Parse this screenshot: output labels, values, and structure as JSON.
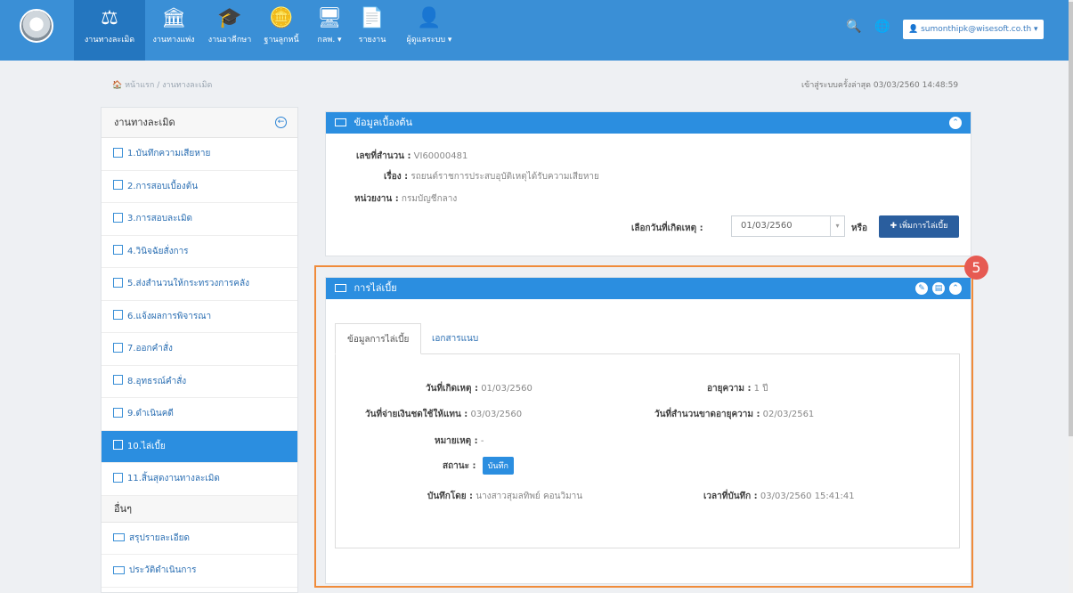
{
  "nav": {
    "items": [
      {
        "label": "งานทางละเมิด",
        "icon": "gavel-icon"
      },
      {
        "label": "งานทางแพ่ง",
        "icon": "bank-icon"
      },
      {
        "label": "งานอาคีกษา",
        "icon": "graduation-cap-icon"
      },
      {
        "label": "ฐานลูกหนี้",
        "icon": "coins-icon"
      },
      {
        "label": "กลพ. ▾",
        "icon": "monitor-icon"
      },
      {
        "label": "รายงาน",
        "icon": "document-icon"
      },
      {
        "label": "ผู้ดูแลระบบ ▾",
        "icon": "user-settings-icon"
      }
    ],
    "search_icon": "search-icon",
    "globe_icon": "globe-icon",
    "user_email": "sumonthipk@wisesoft.co.th ▾"
  },
  "breadcrumb": {
    "home": "หน้าแรก",
    "sep": "/",
    "current": "งานทางละเมิด"
  },
  "last_login": "เข้าสู่ระบบครั้งล่าสุด 03/03/2560 14:48:59",
  "sidebar": {
    "section1": "งานทางละเมิด",
    "items": [
      "1.บันทึกความเสียหาย",
      "2.การสอบเบื้องต้น",
      "3.การสอบละเมิด",
      "4.วินิจฉัยสั่งการ",
      "5.ส่งสำนวนให้กระทรวงการคลัง",
      "6.แจ้งผลการพิจารณา",
      "7.ออกคำสั่ง",
      "8.อุทธรณ์คำสั่ง",
      "9.ดำเนินคดี",
      "10.ไล่เบี้ย",
      "11.สิ้นสุดงานทางละเมิด"
    ],
    "section2": "อื่นๆ",
    "other_items": [
      "สรุปรายละเอียด",
      "ประวัติดำเนินการ"
    ]
  },
  "basic_panel": {
    "title": "ข้อมูลเบื้องต้น",
    "case_no_label": "เลขที่สำนวน :",
    "case_no": "VI60000481",
    "subject_label": "เรื่อง :",
    "subject": "รถยนต์ราชการประสบอุบัติเหตุได้รับความเสียหาย",
    "agency_label": "หน่วยงาน :",
    "agency": "กรมบัญชีกลาง",
    "date_select_label": "เลือกวันที่เกิดเหตุ :",
    "date_value": "01/03/2560",
    "or_label": "หรือ",
    "add_button": "เพิ่มการไล่เบี้ย"
  },
  "recourse_panel": {
    "title": "การไล่เบี้ย",
    "badge": "5",
    "tabs": [
      "ข้อมูลการไล่เบี้ย",
      "เอกสารแนบ"
    ],
    "incident_date_label": "วันที่เกิดเหตุ :",
    "incident_date": "01/03/2560",
    "age_label": "อายุความ :",
    "age": "1 ปี",
    "pay_date_label": "วันที่จ่ายเงินชดใช้ให้แทน :",
    "pay_date": "03/03/2560",
    "expire_label": "วันที่สำนวนขาดอายุความ :",
    "expire_date": "02/03/2561",
    "note_label": "หมายเหตุ :",
    "note": "-",
    "status_label": "สถานะ :",
    "status": "บันทึก",
    "recorded_by_label": "บันทึกโดย :",
    "recorded_by": "นางสาวสุมลทิพย์ คอนวิมาน",
    "recorded_time_label": "เวลาที่บันทึก :",
    "recorded_time": "03/03/2560 15:41:41"
  },
  "colors": {
    "primary": "#2b8ee0",
    "navbar": "#3a8fd6",
    "highlight": "#f08b3a",
    "badge": "#e65a52"
  }
}
